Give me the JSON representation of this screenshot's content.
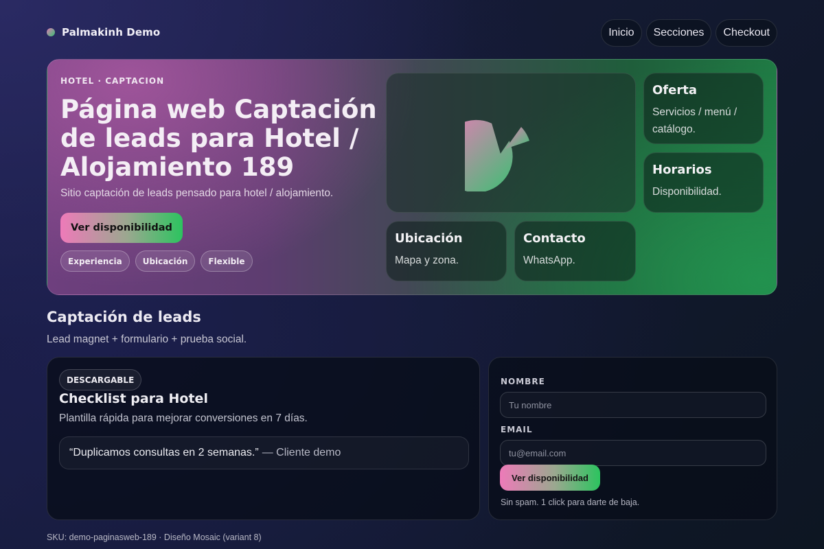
{
  "brand": {
    "name": "Palmakinh Demo"
  },
  "nav": [
    {
      "label": "Inicio"
    },
    {
      "label": "Secciones"
    },
    {
      "label": "Checkout"
    }
  ],
  "hero": {
    "eyebrow": "HOTEL · CAPTACION",
    "title": "Página web Captación de leads para Hotel / Alojamiento 189",
    "subtitle": "Sitio captación de leads pensado para hotel / alojamiento.",
    "cta_label": "Ver disponibilidad",
    "tags": [
      "Experiencia",
      "Ubicación",
      "Flexible"
    ],
    "tiles": {
      "oferta": {
        "title": "Oferta",
        "text": "Servicios / menú / catálogo."
      },
      "horarios": {
        "title": "Horarios",
        "text": "Disponibilidad."
      },
      "ubicacion": {
        "title": "Ubicación",
        "text": "Mapa y zona."
      },
      "contacto": {
        "title": "Contacto",
        "text": "WhatsApp."
      }
    }
  },
  "section": {
    "title": "Captación de leads",
    "subtitle": "Lead magnet + formulario + prueba social."
  },
  "lead_magnet": {
    "badge": "DESCARGABLE",
    "title": "Checklist para Hotel",
    "subtitle": "Plantilla rápida para mejorar conversiones en 7 días.",
    "quote": "“Duplicamos consultas en 2 semanas.”",
    "quote_author": "— Cliente demo"
  },
  "form": {
    "name_label": "NOMBRE",
    "name_placeholder": "Tu nombre",
    "email_label": "EMAIL",
    "email_placeholder": "tu@email.com",
    "submit_label": "Ver disponibilidad",
    "fineprint": "Sin spam. 1 click para darte de baja."
  },
  "footer": {
    "text": "SKU: demo-paginasweb-189 · Diseño Mosaic (variant 8)"
  },
  "colors": {
    "accent_pink": "#ee7ab9",
    "accent_green": "#2cc45f",
    "background": "#141a33"
  }
}
